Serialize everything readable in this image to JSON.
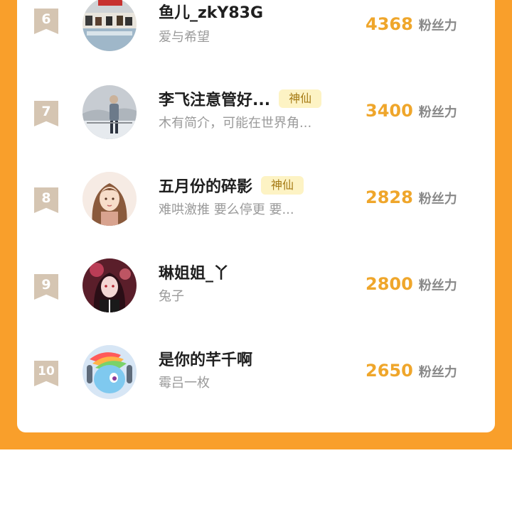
{
  "leaderboard": {
    "entries": [
      {
        "rank": "6",
        "name": "鱼儿_zkY83G",
        "tag": "",
        "bio": "爱与希望",
        "score": "4368",
        "unit": "粉丝力",
        "avatar": "classroom-photo"
      },
      {
        "rank": "7",
        "name": "李飞注意管好...",
        "tag": "神仙",
        "bio": "木有简介，可能在世界角...",
        "score": "3400",
        "unit": "粉丝力",
        "avatar": "winter-portrait-photo"
      },
      {
        "rank": "8",
        "name": "五月份的碎影",
        "tag": "神仙",
        "bio": "难哄激推 要么停更 要...",
        "score": "2828",
        "unit": "粉丝力",
        "avatar": "anime-girl-drawing"
      },
      {
        "rank": "9",
        "name": "琳姐姐_丫",
        "tag": "",
        "bio": "兔子",
        "score": "2800",
        "unit": "粉丝力",
        "avatar": "dark-anime-portrait"
      },
      {
        "rank": "10",
        "name": "是你的芊千啊",
        "tag": "",
        "bio": "霉吕一枚",
        "score": "2650",
        "unit": "粉丝力",
        "avatar": "rainbow-pony-drawing"
      }
    ]
  },
  "colors": {
    "frame": "#f99f2b",
    "score": "#efa62b",
    "rank_badge": "#d5c5b2",
    "tag_bg": "#fdf3c4",
    "tag_text": "#a57a14"
  }
}
